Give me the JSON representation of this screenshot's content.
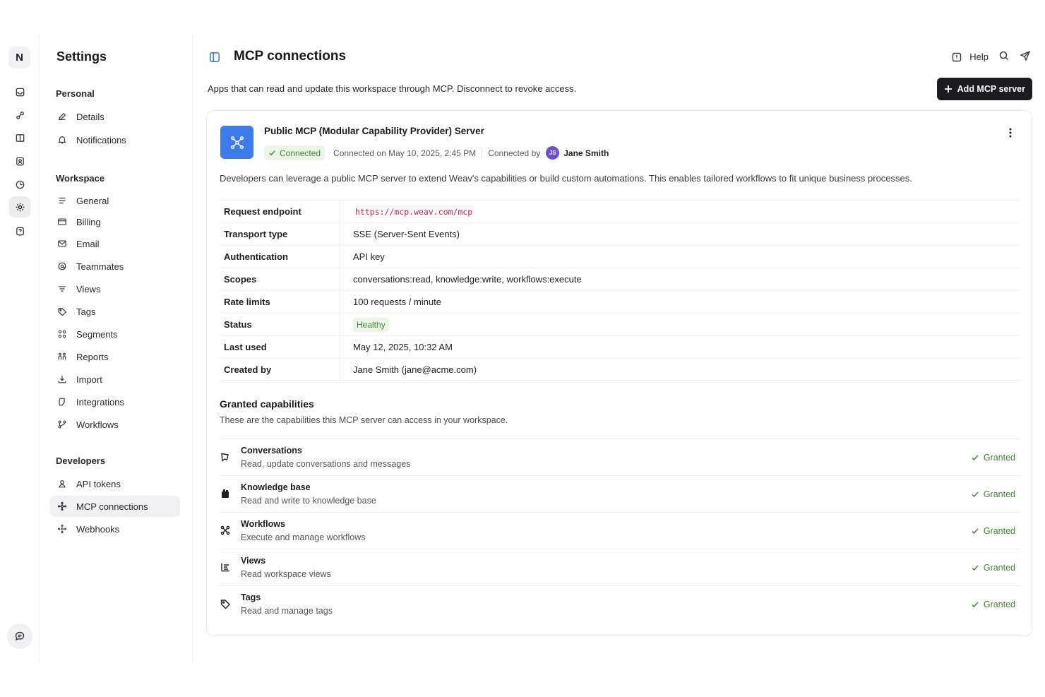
{
  "workspace": {
    "initial": "N"
  },
  "sidebar": {
    "title": "Settings",
    "sections": [
      {
        "label": "Personal",
        "items": [
          {
            "label": "Details",
            "icon": "pencil-icon"
          },
          {
            "label": "Notifications",
            "icon": "bell-icon"
          }
        ]
      },
      {
        "label": "Workspace",
        "items": [
          {
            "label": "General",
            "icon": "list-icon"
          },
          {
            "label": "Billing",
            "icon": "credit-card-icon"
          },
          {
            "label": "Email",
            "icon": "mail-icon"
          },
          {
            "label": "Teammates",
            "icon": "at-sign-icon"
          },
          {
            "label": "Views",
            "icon": "filter-lines-icon"
          },
          {
            "label": "Tags",
            "icon": "tag-icon"
          },
          {
            "label": "Segments",
            "icon": "segments-icon"
          },
          {
            "label": "Reports",
            "icon": "reports-icon"
          },
          {
            "label": "Import",
            "icon": "import-icon"
          },
          {
            "label": "Integrations",
            "icon": "integrations-icon"
          },
          {
            "label": "Workflows",
            "icon": "workflow-branch-icon"
          }
        ]
      },
      {
        "label": "Developers",
        "items": [
          {
            "label": "API tokens",
            "icon": "person-icon"
          },
          {
            "label": "MCP connections",
            "icon": "network-icon",
            "active": true
          },
          {
            "label": "Webhooks",
            "icon": "webhook-icon"
          }
        ]
      }
    ]
  },
  "header": {
    "title": "MCP connections",
    "help_label": "Help",
    "subtitle": "Apps that can read and update this workspace through MCP. Disconnect to revoke access.",
    "add_button_label": "Add MCP server"
  },
  "server": {
    "name": "Public MCP (Modular Capability Provider) Server",
    "status_badge": "Connected",
    "connected_on": "Connected on May 10, 2025, 2:45 PM",
    "connected_by_label": "Connected by",
    "owner_initials": "JS",
    "owner_name": "Jane Smith",
    "description": "Developers can leverage a public MCP server to extend Weav's capabilities or build custom automations. This enables tailored workflows to fit unique business processes.",
    "details": [
      {
        "key": "Request endpoint",
        "value": "https://mcp.weav.com/mcp",
        "kind": "code"
      },
      {
        "key": "Transport type",
        "value": "SSE (Server-Sent Events)",
        "kind": "text"
      },
      {
        "key": "Authentication",
        "value": "API key",
        "kind": "text"
      },
      {
        "key": "Scopes",
        "value": "conversations:read, knowledge:write, workflows:execute",
        "kind": "text"
      },
      {
        "key": "Rate limits",
        "value": "100 requests / minute",
        "kind": "text"
      },
      {
        "key": "Status",
        "value": "Healthy",
        "kind": "badge"
      },
      {
        "key": "Last used",
        "value": "May 12, 2025, 10:32 AM",
        "kind": "text"
      },
      {
        "key": "Created by",
        "value": "Jane Smith (jane@acme.com)",
        "kind": "text"
      }
    ]
  },
  "capabilities": {
    "title": "Granted capabilities",
    "subtitle": "These are the capabilities this MCP server can access in your workspace.",
    "items": [
      {
        "name": "Conversations",
        "desc": "Read, update conversations and messages",
        "status": "Granted",
        "icon": "conversation-icon"
      },
      {
        "name": "Knowledge base",
        "desc": "Read and write to knowledge base",
        "status": "Granted",
        "icon": "book-icon"
      },
      {
        "name": "Workflows",
        "desc": "Execute and manage workflows",
        "status": "Granted",
        "icon": "workflow-icon"
      },
      {
        "name": "Views",
        "desc": "Read workspace views",
        "status": "Granted",
        "icon": "views-icon"
      },
      {
        "name": "Tags",
        "desc": "Read and manage tags",
        "status": "Granted",
        "icon": "tag-icon"
      }
    ]
  },
  "colors": {
    "accent_blue": "#3d7bea",
    "success_green": "#3f8a2e",
    "success_bg": "#eaf5e6",
    "primary_button": "#1c1c1f",
    "avatar_purple": "#6b4ed8"
  }
}
